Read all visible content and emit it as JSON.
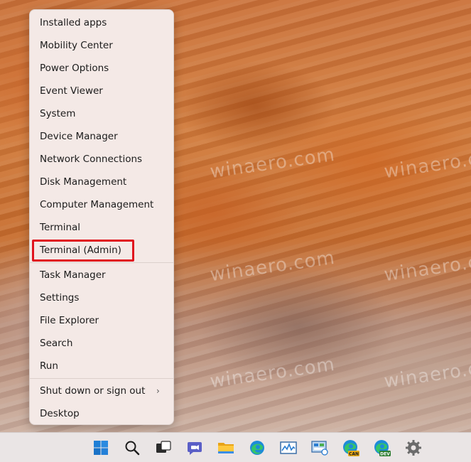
{
  "watermark": "winaero.com",
  "menu": {
    "items": [
      "Installed apps",
      "Mobility Center",
      "Power Options",
      "Event Viewer",
      "System",
      "Device Manager",
      "Network Connections",
      "Disk Management",
      "Computer Management",
      "Terminal",
      "Terminal (Admin)",
      "Task Manager",
      "Settings",
      "File Explorer",
      "Search",
      "Run",
      "Shut down or sign out",
      "Desktop"
    ],
    "highlighted_item": "Terminal (Admin)",
    "highlight_color": "#e0141e"
  },
  "taskbar": {
    "icons": [
      "start-icon",
      "search-icon",
      "task-view-icon",
      "chat-icon",
      "file-explorer-icon",
      "edge-icon",
      "performance-monitor-icon",
      "control-panel-icon",
      "edge-canary-icon",
      "edge-dev-icon",
      "settings-icon"
    ],
    "badges": {
      "canary": "CAN",
      "dev": "DEV"
    }
  }
}
